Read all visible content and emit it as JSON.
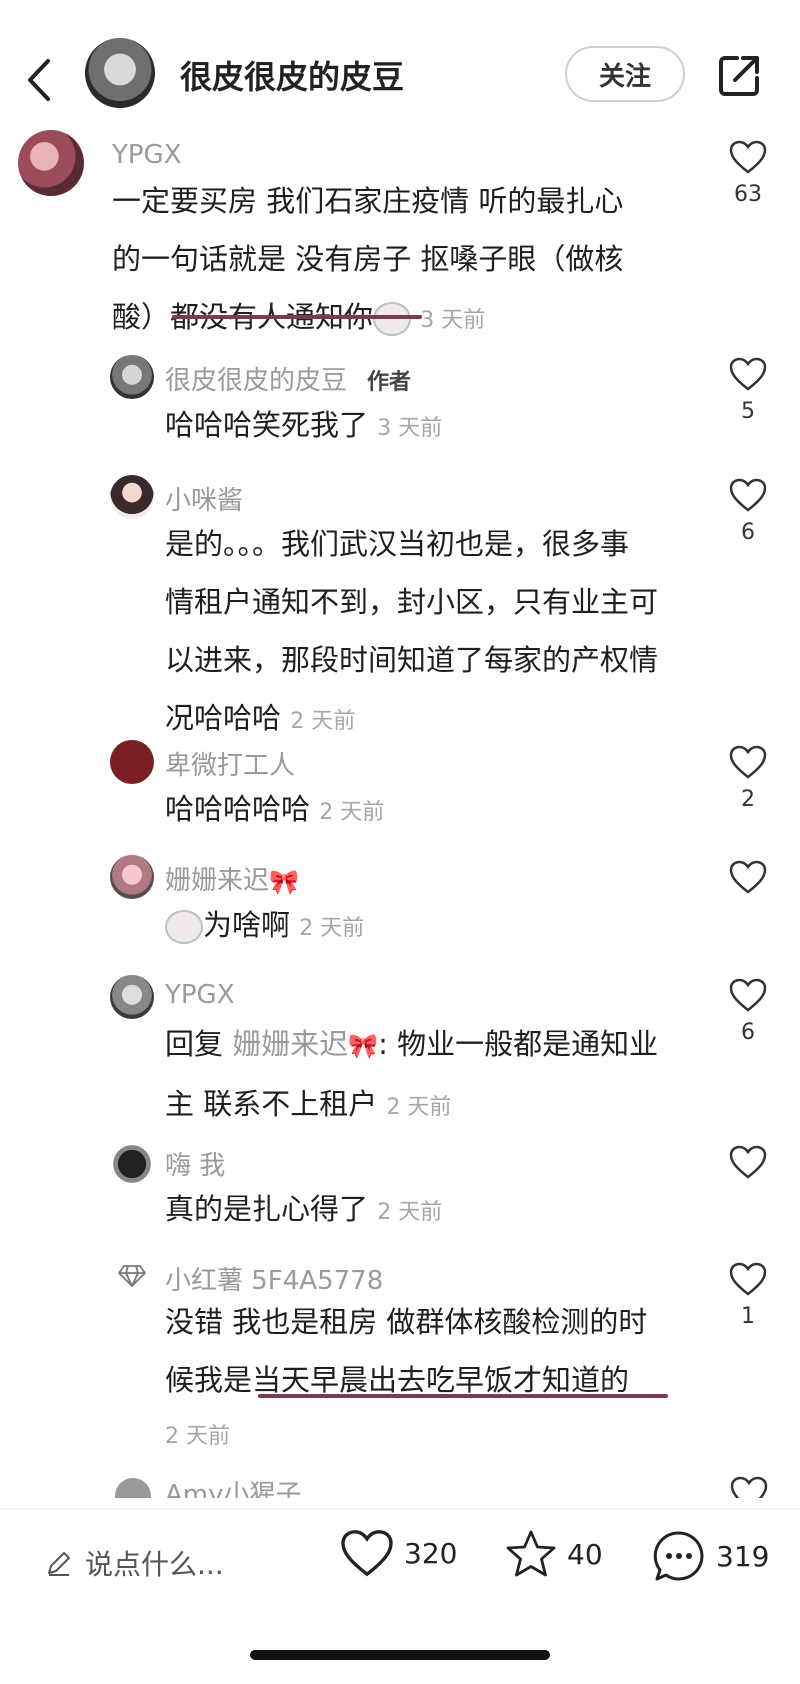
{
  "header": {
    "title": "很皮很皮的皮豆",
    "follow_label": "关注"
  },
  "comments": [
    {
      "name": "YPGX",
      "lines": [
        "一定要买房  我们石家庄疫情 听的最扎心",
        "的一句话就是 没有房子 抠嗓子眼（做核",
        "酸）都没有人通知你"
      ],
      "time": "3 天前",
      "likes": "63"
    },
    {
      "name": "很皮很皮的皮豆",
      "badge": "作者",
      "lines": [
        "哈哈哈笑死我了"
      ],
      "time": "3 天前",
      "likes": "5"
    },
    {
      "name": "小咪酱",
      "lines": [
        "是的。。。我们武汉当初也是，很多事",
        "情租户通知不到，封小区，只有业主可",
        "以进来，那段时间知道了每家的产权情",
        "况哈哈哈"
      ],
      "time": "2 天前",
      "likes": "6"
    },
    {
      "name": "卑微打工人",
      "lines": [
        "哈哈哈哈哈"
      ],
      "time": "2 天前",
      "likes": "2"
    },
    {
      "name": "姗姗来迟",
      "lines": [
        "为啥啊"
      ],
      "time": "2 天前",
      "likes": ""
    },
    {
      "name": "YPGX",
      "reply_prefix": "回复",
      "reply_to": "姗姗来迟",
      "lines": [
        ": 物业一般都是通知业",
        "主 联系不上租户"
      ],
      "time": "2 天前",
      "likes": "6"
    },
    {
      "name": "嗨 我",
      "lines": [
        "真的是扎心得了"
      ],
      "time": "2 天前",
      "likes": ""
    },
    {
      "name": "小红薯 5F4A5778",
      "lines": [
        "没错 我也是租房 做群体核酸检测的时",
        "候我是当天早晨出去吃早饭才知道的"
      ],
      "time": "2 天前",
      "likes": "1"
    },
    {
      "name": "Amy小猩子",
      "lines": [],
      "time": "",
      "likes": ""
    }
  ],
  "bottom": {
    "input_placeholder": "说点什么...",
    "likes": "320",
    "stars": "40",
    "comments": "319"
  }
}
